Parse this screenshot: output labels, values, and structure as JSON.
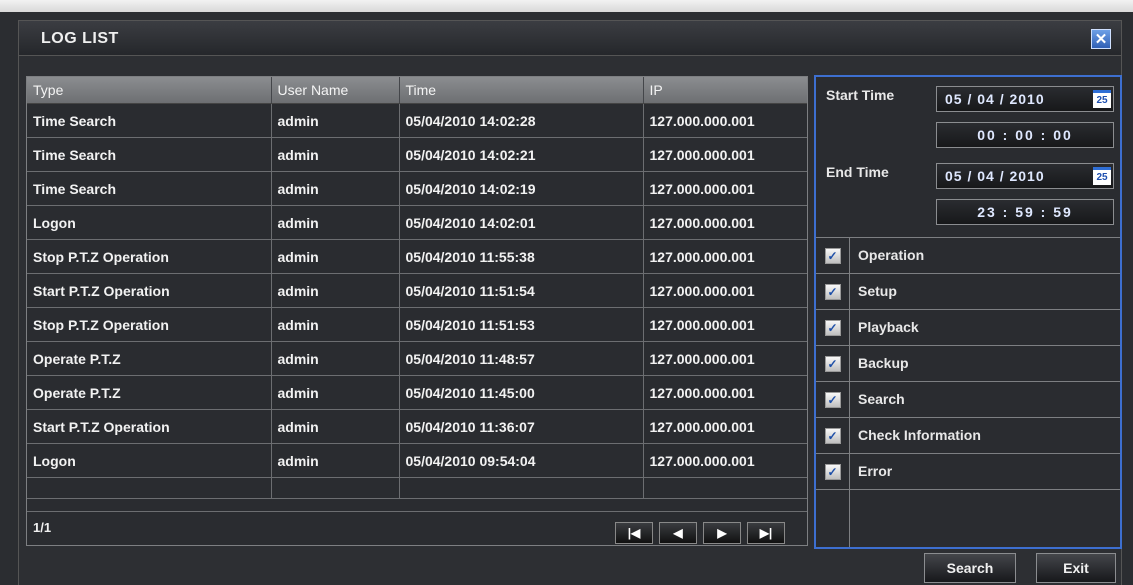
{
  "window": {
    "title": "LOG LIST",
    "close_label": "✕"
  },
  "log_table": {
    "columns": [
      "Type",
      "User Name",
      "Time",
      "IP"
    ],
    "rows": [
      [
        "Time Search",
        "admin",
        "05/04/2010 14:02:28",
        "127.000.000.001"
      ],
      [
        "Time Search",
        "admin",
        "05/04/2010 14:02:21",
        "127.000.000.001"
      ],
      [
        "Time Search",
        "admin",
        "05/04/2010 14:02:19",
        "127.000.000.001"
      ],
      [
        "Logon",
        "admin",
        "05/04/2010 14:02:01",
        "127.000.000.001"
      ],
      [
        "Stop P.T.Z Operation",
        "admin",
        "05/04/2010 11:55:38",
        "127.000.000.001"
      ],
      [
        "Start P.T.Z Operation",
        "admin",
        "05/04/2010 11:51:54",
        "127.000.000.001"
      ],
      [
        "Stop P.T.Z Operation",
        "admin",
        "05/04/2010 11:51:53",
        "127.000.000.001"
      ],
      [
        "Operate P.T.Z",
        "admin",
        "05/04/2010 11:48:57",
        "127.000.000.001"
      ],
      [
        "Operate P.T.Z",
        "admin",
        "05/04/2010 11:45:00",
        "127.000.000.001"
      ],
      [
        "Start P.T.Z Operation",
        "admin",
        "05/04/2010 11:36:07",
        "127.000.000.001"
      ],
      [
        "Logon",
        "admin",
        "05/04/2010 09:54:04",
        "127.000.000.001"
      ]
    ],
    "page_indicator": "1/1",
    "nav_buttons": [
      "first-page",
      "previous-page",
      "next-page",
      "last-page"
    ]
  },
  "filter": {
    "start_time_label": "Start Time",
    "start_date": "05 / 04 / 2010",
    "start_clock": "00 : 00 : 00",
    "end_time_label": "End Time",
    "end_date": "05 / 04 / 2010",
    "end_clock": "23 : 59 : 59",
    "calendar_icon_text": "25",
    "categories": [
      {
        "label": "Operation",
        "checked": true
      },
      {
        "label": "Setup",
        "checked": true
      },
      {
        "label": "Playback",
        "checked": true
      },
      {
        "label": "Backup",
        "checked": true
      },
      {
        "label": "Search",
        "checked": true
      },
      {
        "label": "Check Information",
        "checked": true
      },
      {
        "label": "Error",
        "checked": true
      }
    ],
    "check_mark": "✓"
  },
  "actions": {
    "search_label": "Search",
    "exit_label": "Exit"
  },
  "colors": {
    "accent": "#3d6fd0",
    "background": "#2b2d31",
    "header": "#7d7f82"
  }
}
